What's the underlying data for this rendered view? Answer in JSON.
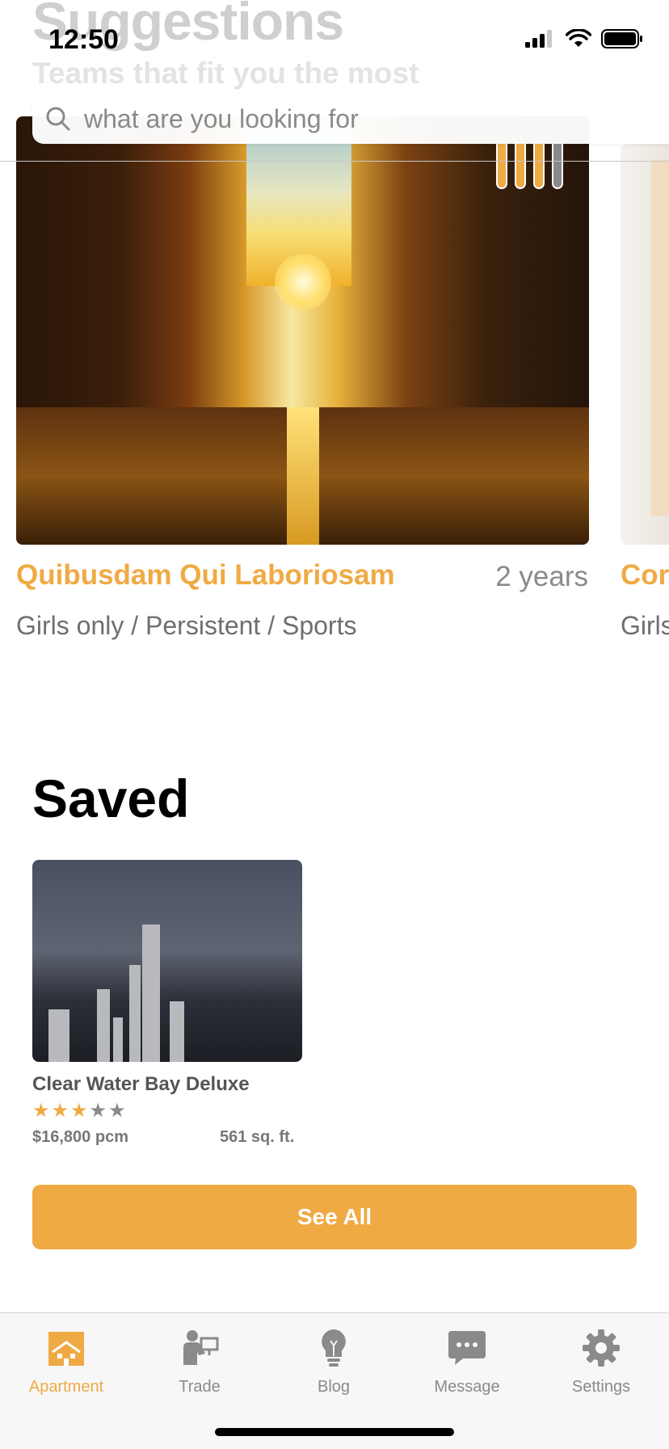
{
  "status_bar": {
    "time": "12:50"
  },
  "header": {
    "title": "Suggestions",
    "subtitle": "Teams that fit you the most",
    "search": {
      "placeholder": "what are you looking for",
      "icon": "search-icon"
    }
  },
  "suggestions": [
    {
      "title": "Quibusdam Qui Laboriosam",
      "duration": "2 years",
      "tags": "Girls only / Persistent / Sports",
      "level": {
        "filled": 3,
        "total": 4
      }
    },
    {
      "title": "Cor",
      "tags": "Girls"
    }
  ],
  "saved": {
    "title": "Saved",
    "items": [
      {
        "name": "Clear Water Bay Deluxe",
        "rating": 3,
        "rating_max": 5,
        "price": "$16,800 pcm",
        "size": "561 sq. ft."
      }
    ],
    "see_all_label": "See All"
  },
  "tabbar": {
    "items": [
      {
        "label": "Apartment",
        "icon": "apartment-icon",
        "active": true
      },
      {
        "label": "Trade",
        "icon": "trade-icon",
        "active": false
      },
      {
        "label": "Blog",
        "icon": "lightbulb-icon",
        "active": false
      },
      {
        "label": "Message",
        "icon": "message-icon",
        "active": false
      },
      {
        "label": "Settings",
        "icon": "gear-icon",
        "active": false
      }
    ]
  },
  "colors": {
    "accent": "#f0aa44",
    "inactive": "#8a8a8a",
    "background": "#ffffff"
  }
}
